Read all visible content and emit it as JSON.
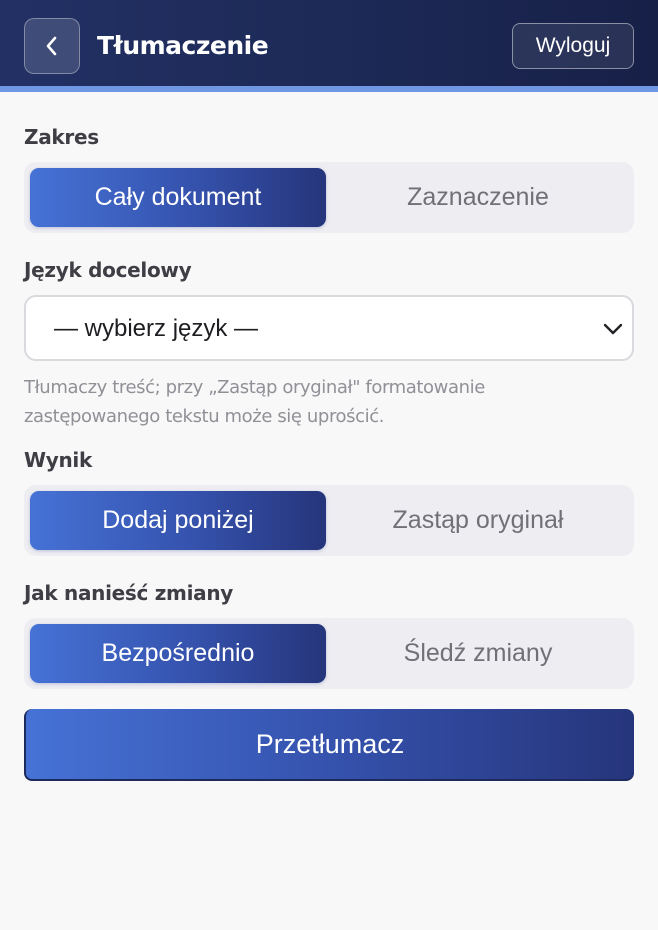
{
  "header": {
    "title": "Tłumaczenie",
    "logout_label": "Wyloguj",
    "back_icon": "chevron-left-icon"
  },
  "scope": {
    "label": "Zakres",
    "options": [
      "Cały dokument",
      "Zaznaczenie"
    ],
    "selected": "Cały dokument"
  },
  "language": {
    "label": "Język docelowy",
    "value": "— wybierz język —",
    "hint": "Tłumaczy treść; przy „Zastąp oryginał\" formatowanie zastępowanego tekstu może się uprościć."
  },
  "output": {
    "label": "Wynik",
    "options": [
      "Dodaj poniżej",
      "Zastąp oryginał"
    ],
    "selected": "Dodaj poniżej"
  },
  "apply": {
    "label": "Jak nanieść zmiany",
    "options": [
      "Bezpośrednio",
      "Śledź zmiany"
    ],
    "selected": "Bezpośrednio"
  },
  "translate_button": "Przetłumacz",
  "colors": {
    "header_bg": "#1d2a57",
    "header_strip": "#6f97e3",
    "accent_start": "#4672d6",
    "accent_end": "#26357b"
  }
}
